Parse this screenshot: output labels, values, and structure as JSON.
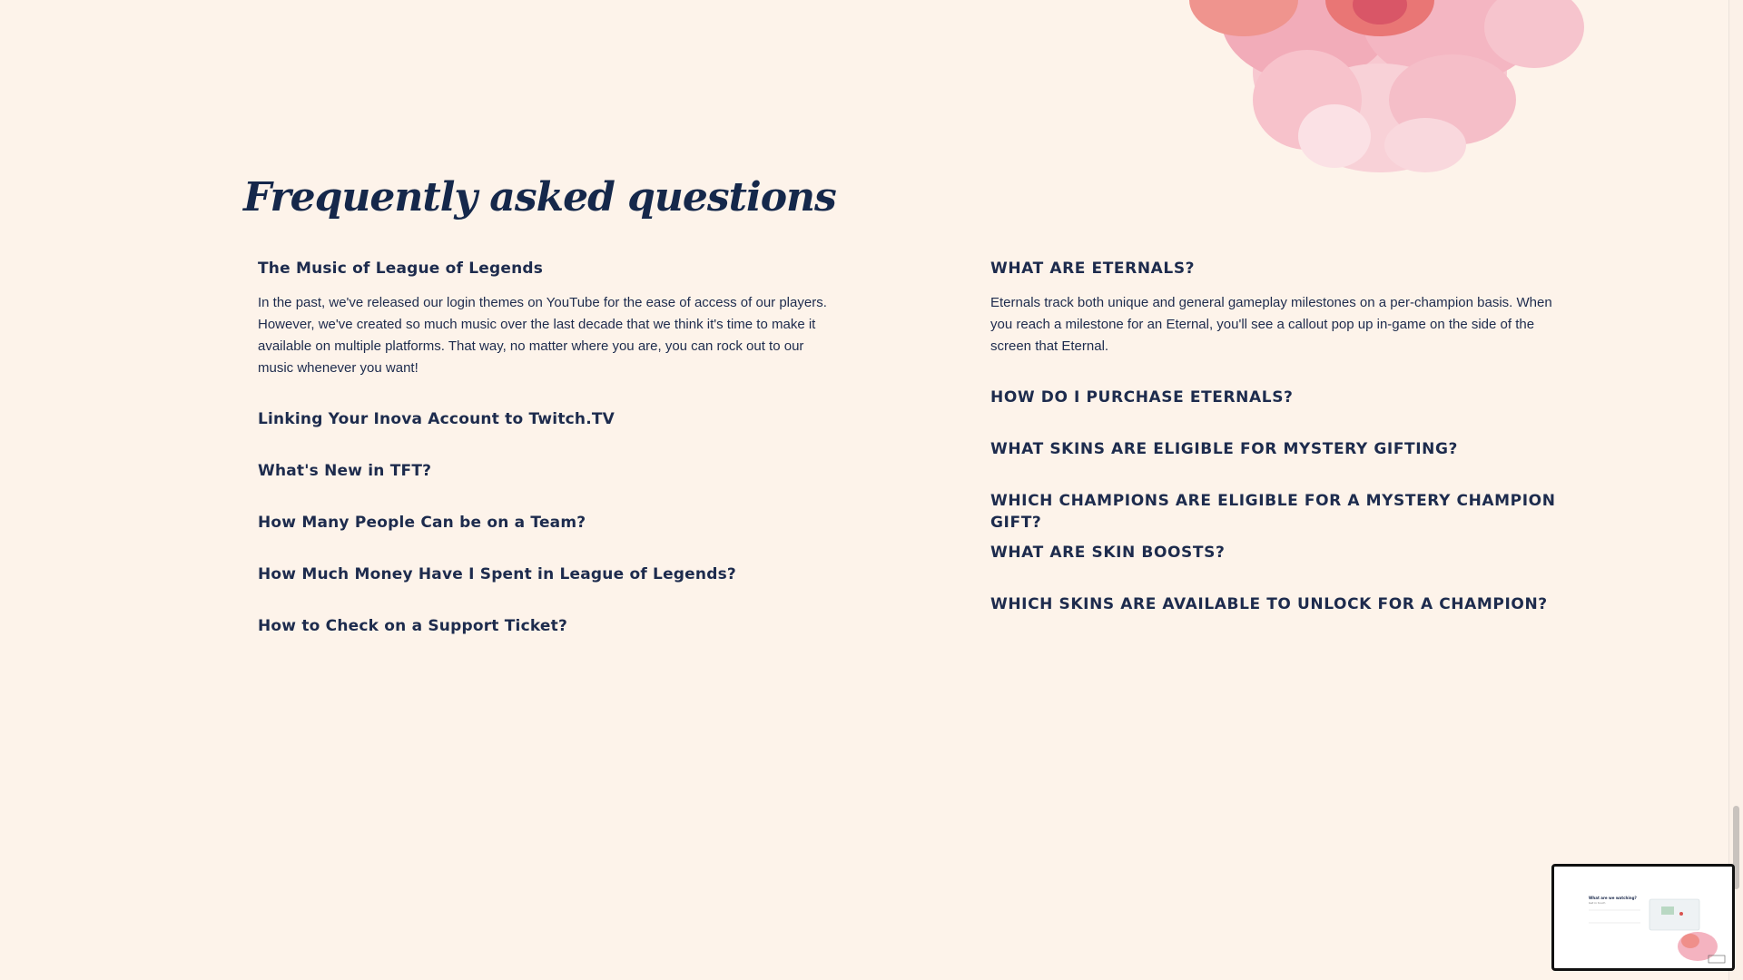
{
  "faq": {
    "title": "Frequently asked questions",
    "left": [
      {
        "question": "The Music of League of Legends",
        "answer": "In the past, we've released our login themes on YouTube for the ease of access of our players. However, we've created so much music over the last decade that we think it's time to make it available on multiple platforms. That way, no matter where you are, you can rock out to our music whenever you want!"
      },
      {
        "question": "Linking Your Inova Account to Twitch.TV"
      },
      {
        "question": "What's New in TFT?"
      },
      {
        "question": "How Many People Can be on a Team?"
      },
      {
        "question": "How Much Money Have I Spent in League of Legends?"
      },
      {
        "question": "How to Check on a Support Ticket?"
      }
    ],
    "right": [
      {
        "question": "WHAT ARE ETERNALS?",
        "answer": "Eternals track both unique and general gameplay milestones on a per-champion basis. When you reach a milestone for an Eternal, you'll see a callout pop up in-game on the side of the screen that Eternal."
      },
      {
        "question": "HOW DO I PURCHASE ETERNALS?"
      },
      {
        "question": "WHAT SKINS ARE ELIGIBLE FOR MYSTERY GIFTING?"
      },
      {
        "question": "WHICH CHAMPIONS ARE ELIGIBLE FOR A MYSTERY CHAMPION GIFT?"
      },
      {
        "question": "WHAT ARE SKIN BOOSTS?"
      },
      {
        "question": "WHICH SKINS ARE AVAILABLE TO UNLOCK FOR A CHAMPION?"
      }
    ]
  },
  "thumbnail": {
    "title": "What are we watching?",
    "subtitle": "Get in touch"
  },
  "colors": {
    "background": "#fdf3ea",
    "text": "#1d2b4d",
    "flower": "#f4a3b4"
  }
}
